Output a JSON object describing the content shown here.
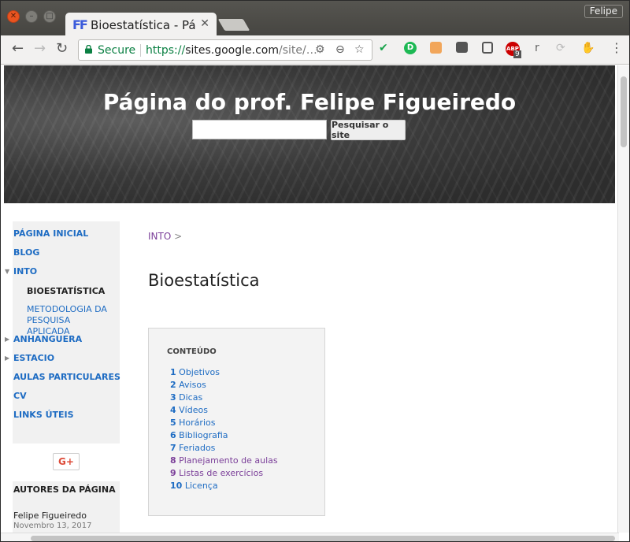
{
  "window": {
    "user": "Felipe"
  },
  "tab": {
    "favicon": "FF",
    "title": "Bioestatística - Págin",
    "close": "✕"
  },
  "toolbar": {
    "back": "←",
    "forward": "→",
    "reload": "↻",
    "secure": "Secure",
    "url_scheme": "https://",
    "url_host": "sites.google.com",
    "url_path": "/site/…",
    "abp_badge": "9",
    "ext_r": "r",
    "menu": "⋮"
  },
  "banner": {
    "title": "Página do prof. Felipe Figueiredo",
    "search_value": "",
    "search_button": "Pesquisar o site"
  },
  "sidebar": {
    "items": [
      "PÁGINA INICIAL",
      "BLOG",
      "INTO",
      "BIOESTATÍSTICA",
      "METODOLOGIA DA PESQUISA APLICADA",
      "ANHANGUERA",
      "ESTACIO",
      "AULAS PARTICULARES",
      "CV",
      "LINKS ÚTEIS"
    ],
    "gplus": "G+",
    "authors_header": "AUTORES DA PÁGINA",
    "author_name": "Felipe Figueiredo",
    "author_date": "Novembro 13, 2017"
  },
  "main": {
    "breadcrumb_link": "INTO",
    "breadcrumb_sep": ">",
    "heading": "Bioestatística",
    "toc_title": "CONTEÚDO",
    "toc": [
      {
        "num": "1",
        "label": "Objetivos",
        "color": "#1e6cc3"
      },
      {
        "num": "2",
        "label": "Avisos",
        "color": "#1e6cc3"
      },
      {
        "num": "3",
        "label": "Dicas",
        "color": "#1e6cc3"
      },
      {
        "num": "4",
        "label": "Vídeos",
        "color": "#1e6cc3"
      },
      {
        "num": "5",
        "label": "Horários",
        "color": "#1e6cc3"
      },
      {
        "num": "6",
        "label": "Bibliografia",
        "color": "#1e6cc3"
      },
      {
        "num": "7",
        "label": "Feriados",
        "color": "#1e6cc3"
      },
      {
        "num": "8",
        "label": "Planejamento de aulas",
        "color": "#7b3f99"
      },
      {
        "num": "9",
        "label": "Listas de exercícios",
        "color": "#7b3f99"
      },
      {
        "num": "10",
        "label": "Licença",
        "color": "#1e6cc3"
      }
    ]
  }
}
